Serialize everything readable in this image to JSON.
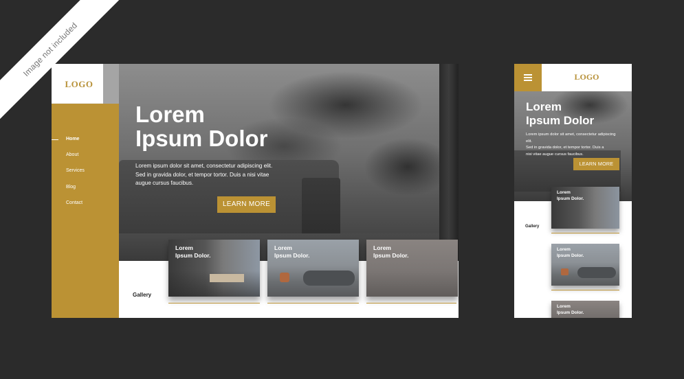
{
  "ribbon": {
    "text": "Image not included"
  },
  "brand": {
    "logo": "LOGO",
    "accent_color": "#bb9234",
    "background_color": "#2b2b2b"
  },
  "desktop": {
    "nav": {
      "items": [
        {
          "label": "Home",
          "active": true
        },
        {
          "label": "About",
          "active": false
        },
        {
          "label": "Services",
          "active": false
        },
        {
          "label": "Blog",
          "active": false
        },
        {
          "label": "Contact",
          "active": false
        }
      ]
    },
    "hero": {
      "title_line1": "Lorem",
      "title_line2": "Ipsum Dolor",
      "body_line1": "Lorem ipsum dolor sit amet, consectetur adipiscing elit.",
      "body_line2": "Sed in gravida dolor, et tempor tortor. Duis a nisi vitae",
      "body_line3": "augue cursus faucibus.",
      "button": "LEARN MORE"
    },
    "gallery": {
      "label": "Gallery",
      "cards": [
        {
          "line1": "Lorem",
          "line2": "Ipsum Dolor."
        },
        {
          "line1": "Lorem",
          "line2": "Ipsum Dolor."
        },
        {
          "line1": "Lorem",
          "line2": "Ipsum Dolor."
        }
      ]
    }
  },
  "mobile": {
    "menu_icon": "hamburger-icon",
    "hero": {
      "title_line1": "Lorem",
      "title_line2": "Ipsum Dolor",
      "body_line1": "Lorem ipsum dolor sit amet, consectetur adipiscing elit.",
      "body_line2": "Sed in gravida dolor, et tempor tortor. Duis a",
      "body_line3": "nisi vitae augue cursus faucibus.",
      "button": "LEARN MORE"
    },
    "gallery": {
      "label": "Gallery",
      "cards": [
        {
          "line1": "Lorem",
          "line2": "Ipsum Dolor."
        },
        {
          "line1": "Lorem",
          "line2": "Ipsum Dolor."
        },
        {
          "line1": "Lorem",
          "line2": "Ipsum Dolor."
        }
      ]
    }
  }
}
